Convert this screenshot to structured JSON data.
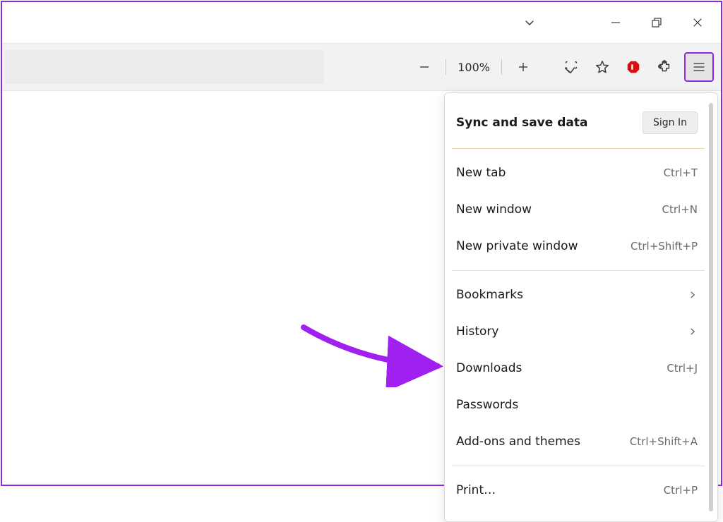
{
  "toolbar": {
    "zoom_value": "100%"
  },
  "menu": {
    "sync": {
      "title": "Sync and save data",
      "signin_label": "Sign In"
    },
    "sections": [
      {
        "items": [
          {
            "label": "New tab",
            "shortcut": "Ctrl+T"
          },
          {
            "label": "New window",
            "shortcut": "Ctrl+N"
          },
          {
            "label": "New private window",
            "shortcut": "Ctrl+Shift+P"
          }
        ]
      },
      {
        "items": [
          {
            "label": "Bookmarks",
            "submenu": true
          },
          {
            "label": "History",
            "submenu": true
          },
          {
            "label": "Downloads",
            "shortcut": "Ctrl+J"
          },
          {
            "label": "Passwords"
          },
          {
            "label": "Add-ons and themes",
            "shortcut": "Ctrl+Shift+A"
          }
        ]
      },
      {
        "items": [
          {
            "label": "Print…",
            "shortcut": "Ctrl+P"
          }
        ]
      }
    ]
  }
}
